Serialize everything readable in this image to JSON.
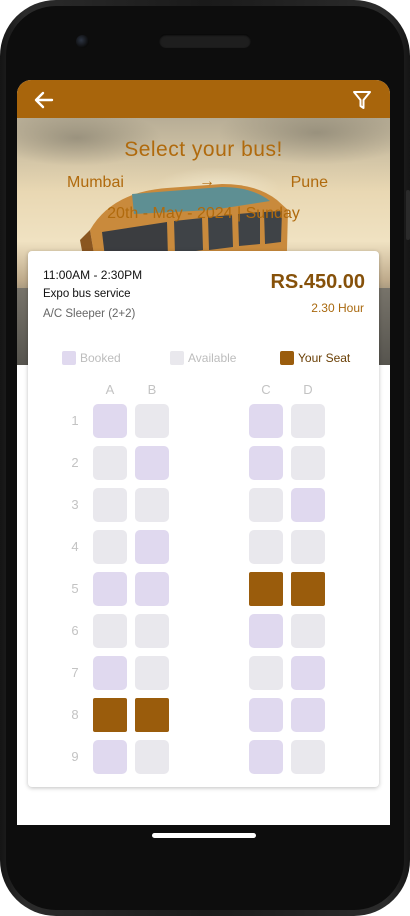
{
  "header": {
    "back_icon": "arrow-left-icon",
    "filter_icon": "filter-funnel-icon"
  },
  "hero": {
    "title": "Select your bus!",
    "from": "Mumbai",
    "arrow": "→",
    "to": "Pune",
    "date": "20th - May - 2024 | Sunday"
  },
  "trip": {
    "time": "11:00AM - 2:30PM",
    "operator": "Expo bus service",
    "bus_type": "A/C Sleeper (2+2)",
    "price": "RS.450.00",
    "duration": "2.30 Hour"
  },
  "legend": {
    "booked": "Booked",
    "available": "Available",
    "your_seat": "Your Seat"
  },
  "columns": [
    "A",
    "B",
    "C",
    "D"
  ],
  "rows": [
    "1",
    "2",
    "3",
    "4",
    "5",
    "6",
    "7",
    "8",
    "9"
  ],
  "seats": [
    [
      "booked",
      "available",
      "booked",
      "available"
    ],
    [
      "available",
      "booked",
      "booked",
      "available"
    ],
    [
      "available",
      "available",
      "available",
      "booked"
    ],
    [
      "available",
      "booked",
      "available",
      "available"
    ],
    [
      "booked",
      "booked",
      "mine",
      "mine"
    ],
    [
      "available",
      "available",
      "booked",
      "available"
    ],
    [
      "booked",
      "available",
      "available",
      "booked"
    ],
    [
      "mine",
      "mine",
      "booked",
      "booked"
    ],
    [
      "booked",
      "available",
      "booked",
      "available"
    ]
  ],
  "colors": {
    "accent": "#a8650c",
    "your_seat": "#9a5c0c",
    "booked": "#e0d9ef",
    "available": "#e9e8ed"
  }
}
